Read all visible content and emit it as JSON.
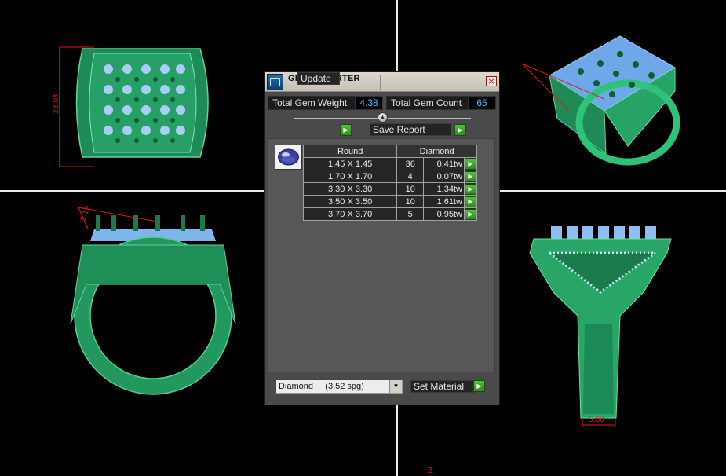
{
  "dialog": {
    "title": "GEM REPORTER",
    "close_glyph": "×",
    "total_weight_label": "Total Gem Weight",
    "total_weight_value": "4.38",
    "total_count_label": "Total Gem Count",
    "total_count_value": "65",
    "collapse_glyph": "▲",
    "update_label": "Update",
    "save_report_label": "Save Report",
    "go_glyph": "▶",
    "table": {
      "headers": [
        "Round",
        "Diamond"
      ],
      "rows": [
        {
          "size": "1.45 X 1.45",
          "count": "36",
          "weight": "0.41tw"
        },
        {
          "size": "1.70 X 1.70",
          "count": "4",
          "weight": "0.07tw"
        },
        {
          "size": "3.30 X 3.30",
          "count": "10",
          "weight": "1.34tw"
        },
        {
          "size": "3.50 X 3.50",
          "count": "10",
          "weight": "1.61tw"
        },
        {
          "size": "3.70 X 3.70",
          "count": "5",
          "weight": "0.95tw"
        }
      ]
    },
    "material_value": "Diamond     (3.52 spg)",
    "material_dropdown_glyph": "▼",
    "set_material_label": "Set Material"
  },
  "viewports": {
    "top_left_dimension": "23.04",
    "bottom_left_dimension": "5.19",
    "bottom_right_dimension": "5.00",
    "axis_label": "Z"
  },
  "colors": {
    "ring_green": "#2aa86a",
    "gem_blue": "#8fbff2",
    "dimension_red": "#e01818",
    "value_blue": "#52b6ff",
    "go_green": "#3fa62a"
  }
}
